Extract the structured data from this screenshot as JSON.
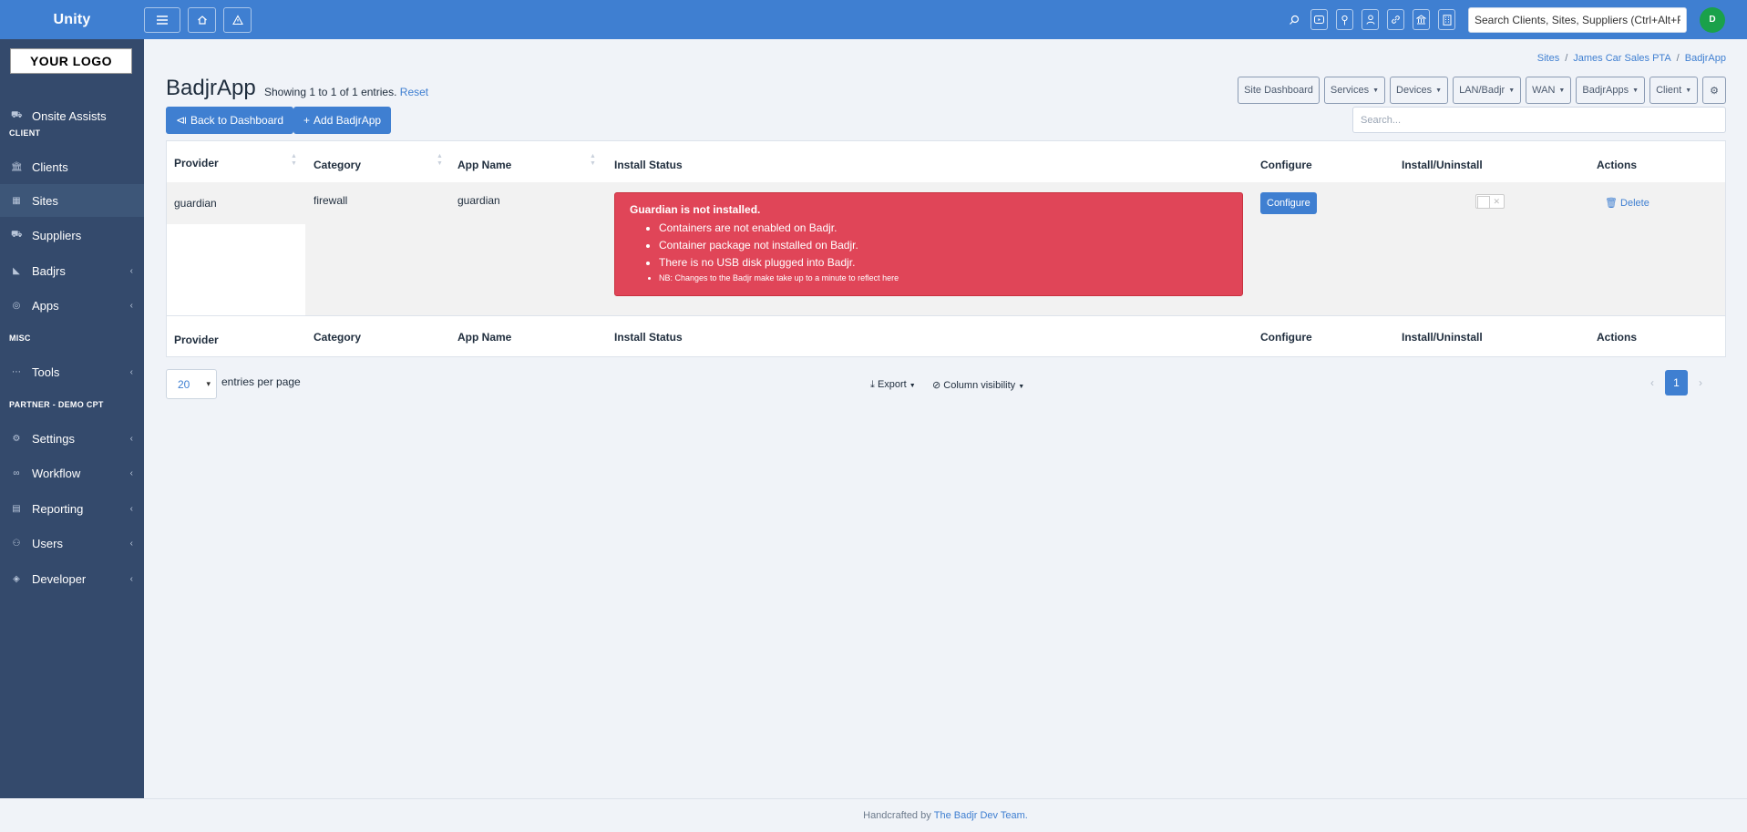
{
  "topbar": {
    "brand": "Unity",
    "search_placeholder": "Search Clients, Sites, Suppliers (Ctrl+Alt+F)",
    "avatar_initial": "D"
  },
  "sidebar": {
    "logo_text": "YOUR LOGO",
    "onsite_assists": "Onsite Assists",
    "section_client": "CLIENT",
    "clients": "Clients",
    "sites": "Sites",
    "suppliers": "Suppliers",
    "badjrs": "Badjrs",
    "apps": "Apps",
    "section_misc": "MISC",
    "tools": "Tools",
    "section_partner": "PARTNER - DEMO CPT",
    "settings": "Settings",
    "workflow": "Workflow",
    "reporting": "Reporting",
    "users": "Users",
    "developer": "Developer"
  },
  "breadcrumb": {
    "sites": "Sites",
    "site": "James Car Sales PTA",
    "current": "BadjrApp"
  },
  "page": {
    "title": "BadjrApp",
    "showing": "Showing 1 to 1 of 1 entries.",
    "reset": "Reset",
    "back_button": "Back to Dashboard",
    "add_button": "Add BadjrApp",
    "table_search_placeholder": "Search..."
  },
  "pills": {
    "site_dashboard": "Site Dashboard",
    "services": "Services",
    "devices": "Devices",
    "lan": "LAN/Badjr",
    "wan": "WAN",
    "badjrapps": "BadjrApps",
    "client": "Client"
  },
  "table": {
    "headers": {
      "provider": "Provider",
      "category": "Category",
      "app_name": "App Name",
      "install_status": "Install Status",
      "configure": "Configure",
      "install_uninstall": "Install/Uninstall",
      "actions": "Actions"
    },
    "row": {
      "provider": "guardian",
      "category": "firewall",
      "app_name": "guardian",
      "configure_label": "Configure",
      "delete_label": "Delete"
    },
    "alert": {
      "heading": "Guardian is not installed.",
      "items": [
        "Containers are not enabled on Badjr.",
        "Container package not installed on Badjr.",
        "There is no USB disk plugged into Badjr.",
        "NB: Changes to the Badjr make take up to a minute to reflect here"
      ]
    }
  },
  "table_footer": {
    "per_page_value": "20",
    "per_page_label": "entries per page",
    "export": "Export",
    "column_visibility": "Column visibility",
    "page_number": "1"
  },
  "footer": {
    "prefix": "Handcrafted by",
    "link": "The Badjr Dev Team."
  },
  "colors": {
    "primary": "#3f7fd1",
    "sidebar": "#344a6c",
    "alert": "#e04558",
    "avatar": "#1aa14a"
  }
}
